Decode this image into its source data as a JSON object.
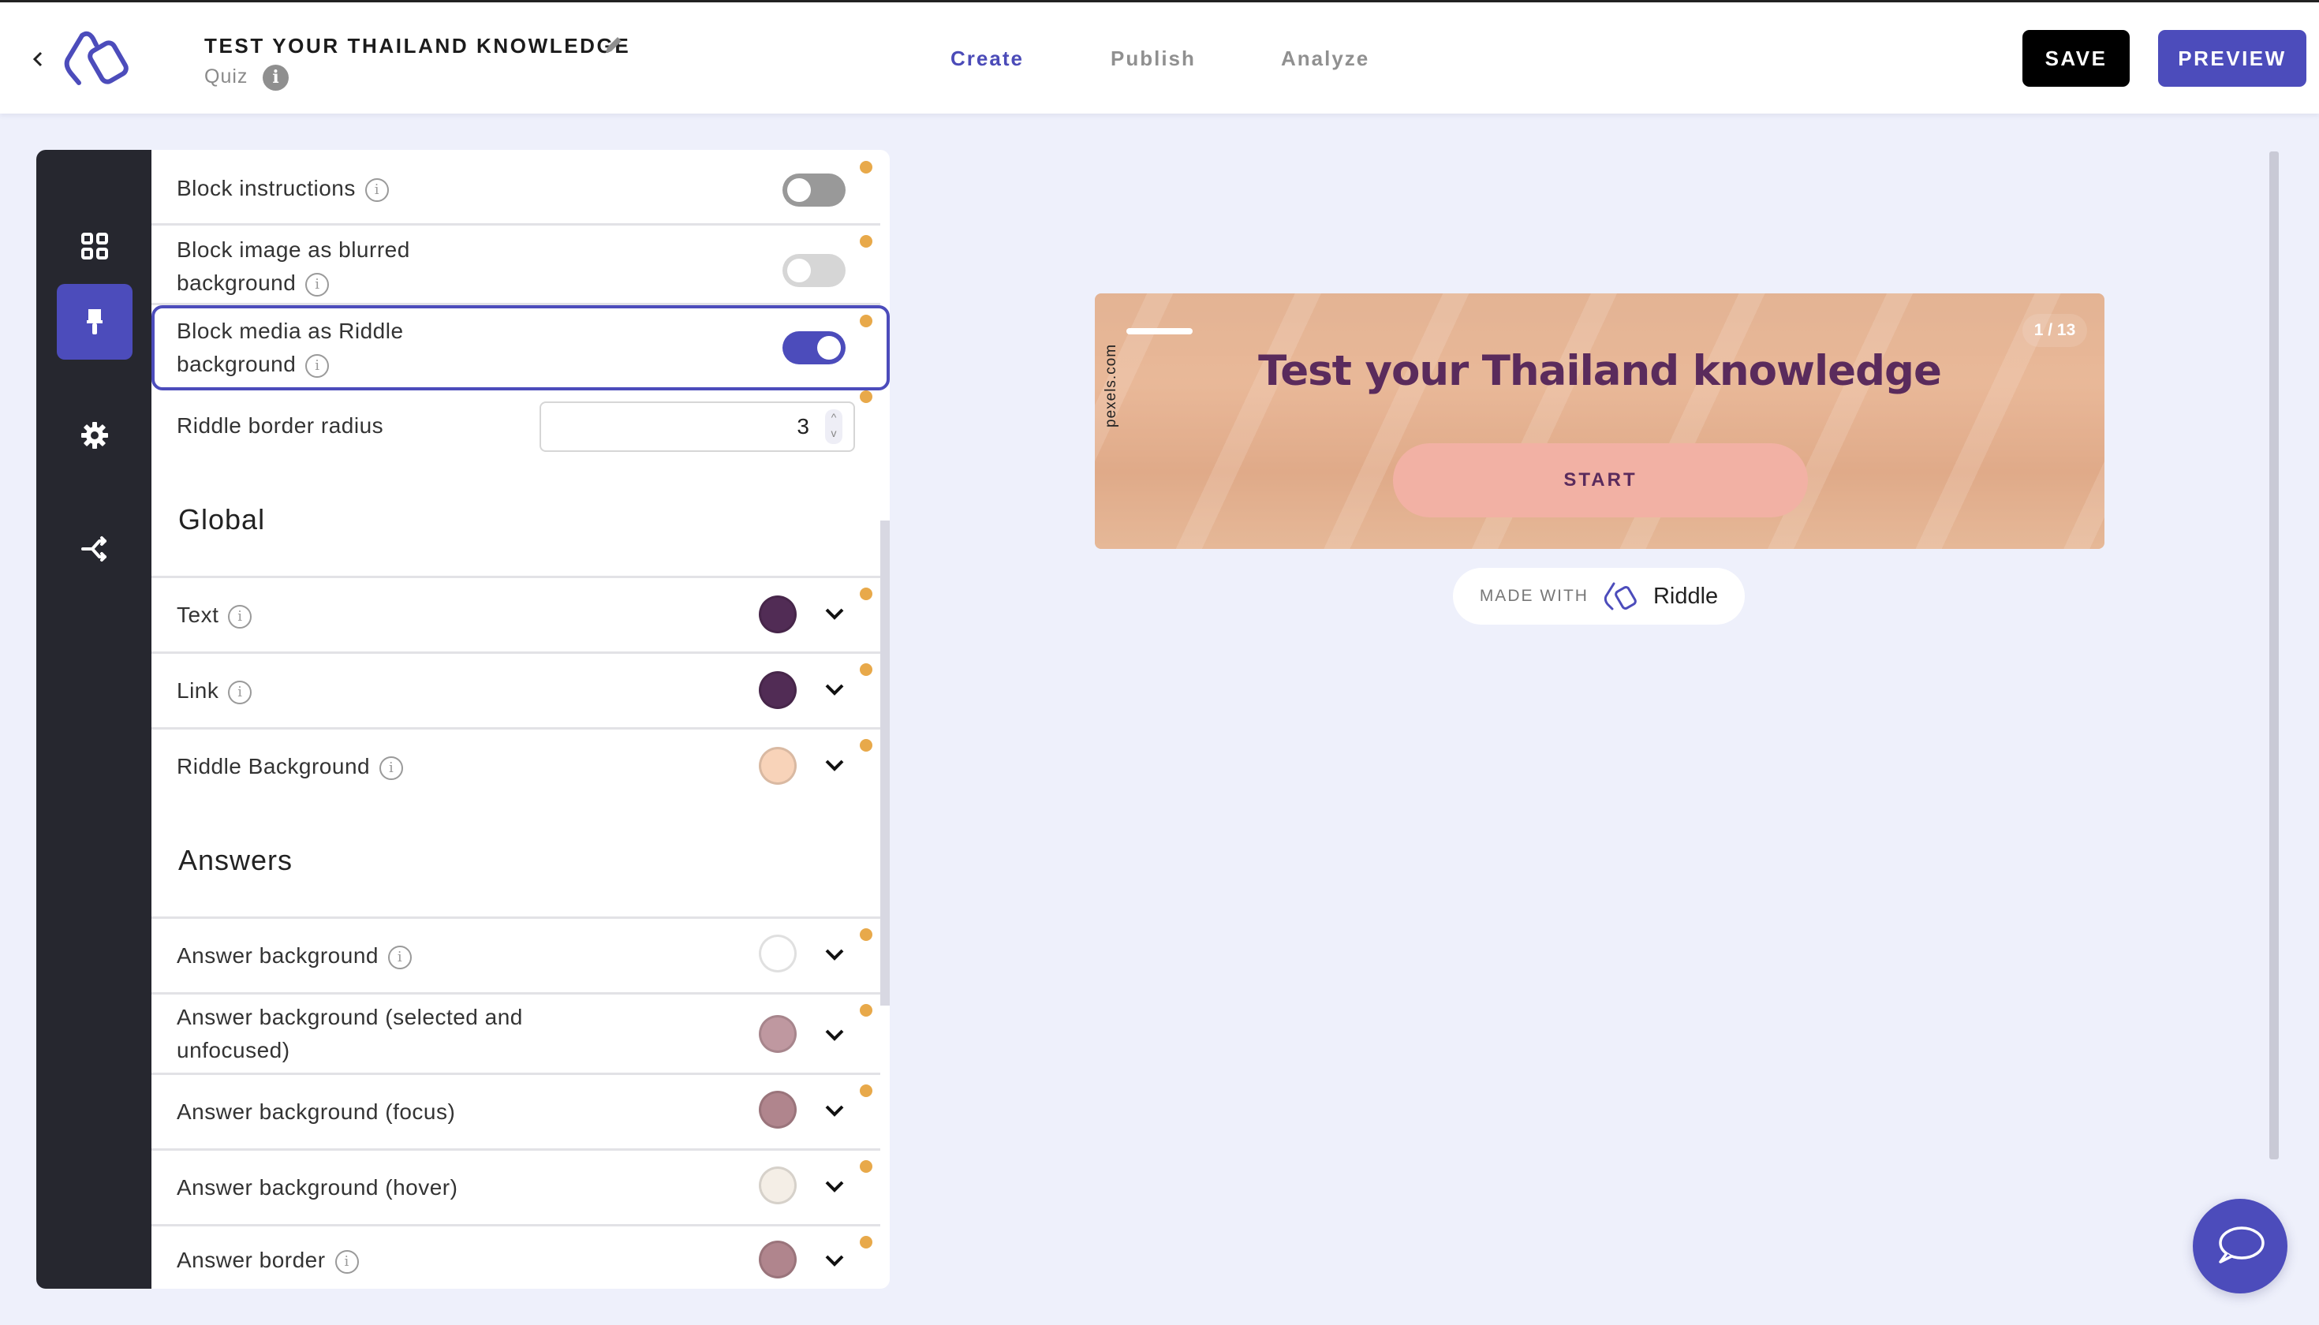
{
  "header": {
    "title": "TEST YOUR THAILAND KNOWLEDGE",
    "subtitle": "Quiz",
    "info_glyph": "i",
    "back_icon": "chevron-left-icon",
    "edit_icon": "pencil-icon",
    "tabs": [
      {
        "label": "Create",
        "active": true
      },
      {
        "label": "Publish",
        "active": false
      },
      {
        "label": "Analyze",
        "active": false
      }
    ],
    "save_label": "SAVE",
    "preview_label": "PREVIEW"
  },
  "rail": {
    "items": [
      {
        "icon": "blocks-grid-icon",
        "active": false
      },
      {
        "icon": "paintbrush-icon",
        "active": true
      },
      {
        "icon": "gear-icon",
        "active": false
      },
      {
        "icon": "share-icon",
        "active": false
      }
    ]
  },
  "settings": {
    "info_glyph": "i",
    "toggles": [
      {
        "label": "Block instructions",
        "info": true,
        "state": "off"
      },
      {
        "label": "Block image as blurred background",
        "info": true,
        "state": "off-disabled"
      },
      {
        "label": "Block media as Riddle background",
        "info": true,
        "state": "on",
        "focused": true
      }
    ],
    "border_radius": {
      "label": "Riddle border radius",
      "value": "3",
      "spin_up": "^",
      "spin_down": "v"
    },
    "sections": [
      {
        "title": "Global",
        "colors": [
          {
            "label": "Text",
            "info": true,
            "color": "#512c55"
          },
          {
            "label": "Link",
            "info": true,
            "color": "#512c55"
          },
          {
            "label": "Riddle Background",
            "info": true,
            "color": "#f8d3b9"
          }
        ]
      },
      {
        "title": "Answers",
        "colors": [
          {
            "label": "Answer background",
            "info": true,
            "color": "#ffffff"
          },
          {
            "label": "Answer background (selected and unfocused)",
            "info": false,
            "color": "#bf98a0"
          },
          {
            "label": "Answer background (focus)",
            "info": false,
            "color": "#b0858d"
          },
          {
            "label": "Answer background (hover)",
            "info": false,
            "color": "#f4eee6"
          },
          {
            "label": "Answer border",
            "info": true,
            "color": "#b0858d"
          }
        ]
      }
    ],
    "changed_indicator_color": "#e8a94a"
  },
  "preview": {
    "counter": "1 / 13",
    "title": "Test your Thailand knowledge",
    "start_label": "START",
    "image_credit": "pexels.com",
    "made_with_label": "MADE WITH",
    "made_with_brand": "Riddle"
  },
  "chat": {
    "icon": "chat-bubble-icon"
  },
  "colors": {
    "accent": "#4c4cbb",
    "rail_bg": "#26272f",
    "page_bg": "#eef0fb",
    "title_text": "#5a2b5c",
    "start_button": "#f2b1a4"
  }
}
